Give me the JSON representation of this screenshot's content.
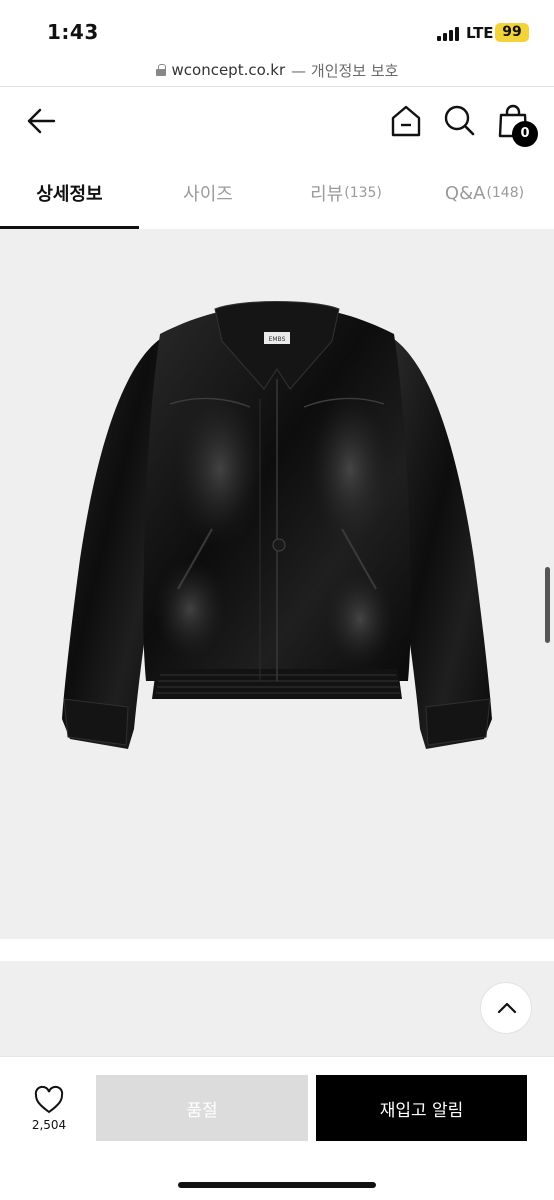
{
  "status_bar": {
    "time": "1:43",
    "network": "LTE",
    "battery": "99",
    "battery_color": "#f3d33a"
  },
  "url_bar": {
    "host": "wconcept.co.kr",
    "privacy_note": "— 개인정보 보호"
  },
  "nav": {
    "back_icon": "arrow-left-icon",
    "home_icon": "home-icon",
    "search_icon": "search-icon",
    "cart_icon": "shopping-bag-icon",
    "cart_count": "0"
  },
  "tabs": [
    {
      "label": "상세정보",
      "count": "",
      "active": true
    },
    {
      "label": "사이즈",
      "count": "",
      "active": false
    },
    {
      "label": "리뷰",
      "count": "(135)",
      "active": false
    },
    {
      "label": "Q&A",
      "count": "(148)",
      "active": false
    }
  ],
  "product": {
    "image_desc_icon": "leather-jacket-image",
    "label_tag": "EMBS"
  },
  "bottom_bar": {
    "like_icon": "heart-icon",
    "like_count": "2,504",
    "soldout_label": "품절",
    "restock_label": "재입고 알림"
  },
  "colors": {
    "accent": "#000000",
    "disabled": "#dcdcdc",
    "background_gray": "#efefef"
  }
}
